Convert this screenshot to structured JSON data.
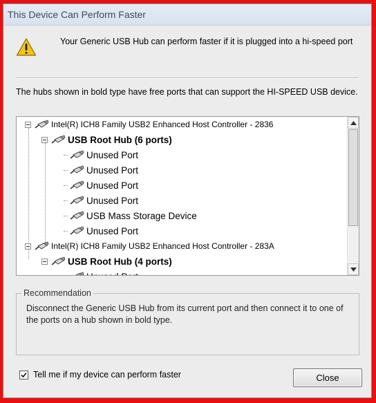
{
  "window": {
    "title": "This Device Can Perform Faster"
  },
  "message": {
    "icon": "warning-icon",
    "text": "Your Generic USB Hub can perform faster if it is plugged into a hi-speed port"
  },
  "description": "The hubs shown in bold type have free ports that can support the HI-SPEED USB device.",
  "tree": {
    "nodes": [
      {
        "label": "Intel(R) ICH8 Family USB2 Enhanced Host Controller - 2836",
        "level": 0,
        "expanded": true
      },
      {
        "label": "USB Root Hub (6 ports)",
        "level": 1,
        "expanded": true,
        "bold": true
      },
      {
        "label": "Unused Port",
        "level": 2
      },
      {
        "label": "Unused Port",
        "level": 2
      },
      {
        "label": "Unused Port",
        "level": 2
      },
      {
        "label": "Unused Port",
        "level": 2
      },
      {
        "label": "USB Mass Storage Device",
        "level": 2
      },
      {
        "label": "Unused Port",
        "level": 2
      },
      {
        "label": "Intel(R) ICH8 Family USB2 Enhanced Host Controller - 283A",
        "level": 0,
        "expanded": true
      },
      {
        "label": "USB Root Hub (4 ports)",
        "level": 1,
        "expanded": true,
        "bold": true
      },
      {
        "label": "Unused Port",
        "level": 2
      }
    ],
    "scroll_fraction": 0.0
  },
  "recommendation": {
    "legend": "Recommendation",
    "text": "Disconnect the Generic USB Hub from its current port and then connect it to one of the ports on a hub shown in bold type."
  },
  "checkbox": {
    "label": "Tell me if my device can perform faster",
    "checked": true
  },
  "buttons": {
    "close": "Close"
  }
}
